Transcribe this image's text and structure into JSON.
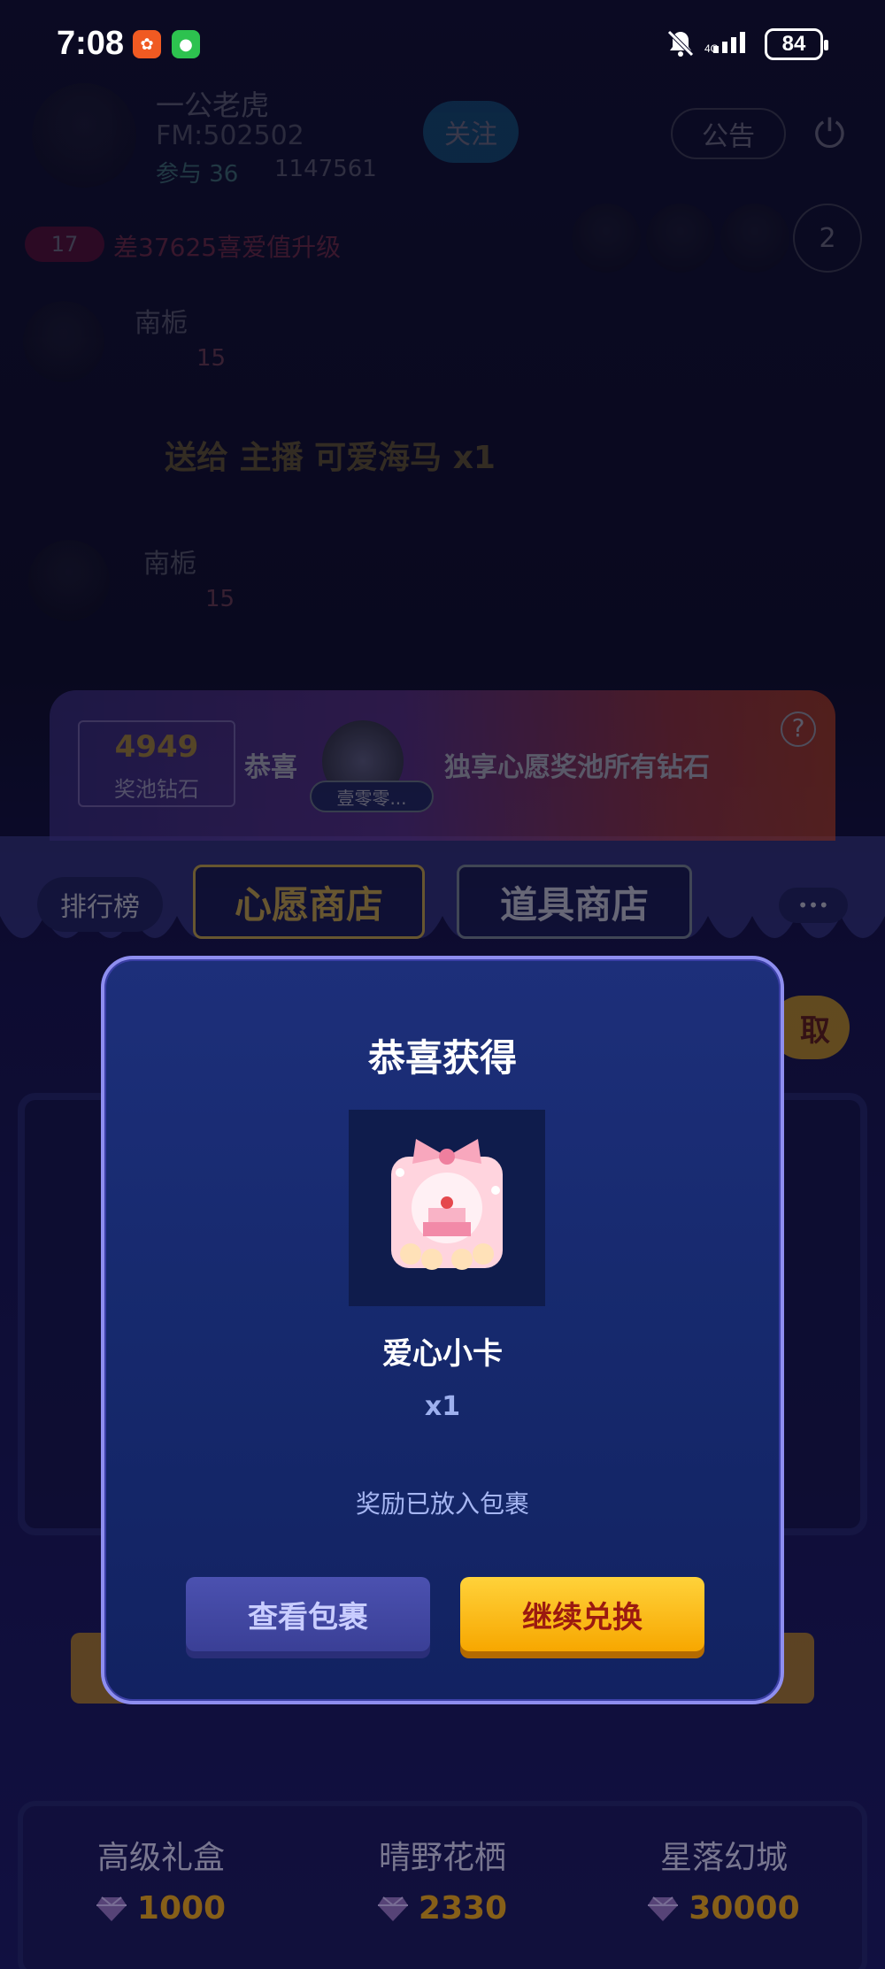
{
  "status_bar": {
    "time": "7:08",
    "apps": [
      "qq-music-badge",
      "wechat-badge"
    ],
    "icons": [
      "mute-bell-icon",
      "signal-icon"
    ],
    "battery": "84"
  },
  "room": {
    "host_name": "一公老虎",
    "fm_id": "FM:502502",
    "follow_label": "关注",
    "participants": "参与 36",
    "hearts": "1147561",
    "notice_label": "公告",
    "level_badge": "17",
    "upgrade_text": "差37625喜爱值升级",
    "online_count": "2",
    "messages": [
      {
        "user": "南栀",
        "level": "15"
      },
      {
        "user": "南栀",
        "level": "15"
      }
    ],
    "gift_message": {
      "verb": "送给",
      "role": "主播",
      "target": "可爱海马",
      "qty": "x1"
    }
  },
  "banner": {
    "pool_value": "4949",
    "pool_label": "奖池钻石",
    "congrats": "恭喜",
    "winner_name": "壹零零...",
    "slogan": "独享心愿奖池所有钻石"
  },
  "tabs": {
    "rank": "排行榜",
    "wish_shop": "心愿商店",
    "prop_shop": "道具商店",
    "more": "•••",
    "claim_partial": "取"
  },
  "modal": {
    "title": "恭喜获得",
    "prize_name": "爱心小卡",
    "quantity": "x1",
    "note": "奖励已放入包裹",
    "view_button": "查看包裹",
    "continue_button": "继续兑换"
  },
  "shop_items": [
    {
      "name": "高级礼盒",
      "price": "1000"
    },
    {
      "name": "晴野花栖",
      "price": "2330"
    },
    {
      "name": "星落幻城",
      "price": "30000"
    }
  ],
  "colors": {
    "modal_bg": "#16296d",
    "modal_border": "#8e8ef0",
    "continue_button": "#ffc21a",
    "price_text": "#f0a91c"
  }
}
